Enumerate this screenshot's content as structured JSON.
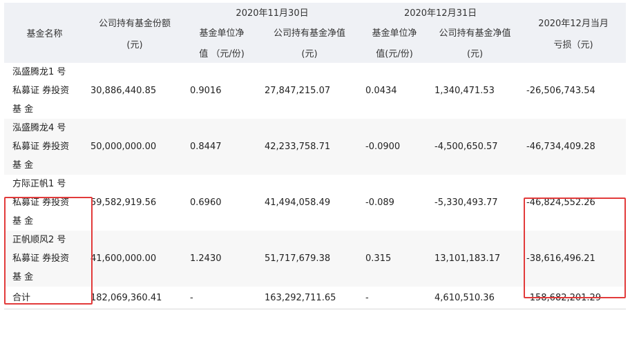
{
  "headers": {
    "fund_name": "基金名称",
    "company_shares": "公司持有基金份额",
    "company_shares_unit": "(元)",
    "period1": "2020年11月30日",
    "period2": "2020年12月31日",
    "nav1_line1": "基金单位净",
    "nav1_line2": "值 （元/份)",
    "net_value1_line1": "公司持有基金净值",
    "net_value1_line2": "(元)",
    "nav2_line1": "基金单位净",
    "nav2_line2": "值(元/份)",
    "net_value2_line1": "公司持有基金净值",
    "net_value2_line2": "(元)",
    "loss_line1": "2020年12月当月",
    "loss_line2": "亏损（元)"
  },
  "rows": [
    {
      "name1": "泓盛腾龙1 号",
      "name2": "私募证 券投资",
      "name3": "基 金",
      "shares": "30,886,440.85",
      "nav1": "0.9016",
      "value1": "27,847,215.07",
      "nav2": "0.0434",
      "value2": "1,340,471.53",
      "loss": "-26,506,743.54"
    },
    {
      "name1": "泓盛腾龙4 号",
      "name2": "私募证 券投资",
      "name3": "基 金",
      "shares": "50,000,000.00",
      "nav1": "0.8447",
      "value1": "42,233,758.71",
      "nav2": "-0.0900",
      "value2": "-4,500,650.57",
      "loss": "-46,734,409.28"
    },
    {
      "name1": "方际正帆1 号",
      "name2": "私募证 券投资",
      "name3": "基 金",
      "shares": "59,582,919.56",
      "nav1": "0.6960",
      "value1": "41,494,058.49",
      "nav2": "-0.089",
      "value2": "-5,330,493.77",
      "loss": "-46,824,552.26"
    },
    {
      "name1": "正帆顺风2 号",
      "name2": "私募证 券投资",
      "name3": "基 金",
      "shares": "41,600,000.00",
      "nav1": "1.2430",
      "value1": "51,717,679.38",
      "nav2": "0.315",
      "value2": "13,101,183.17",
      "loss": "-38,616,496.21"
    }
  ],
  "total": {
    "name": "合计",
    "shares": "182,069,360.41",
    "nav1": "-",
    "value1": "163,292,711.65",
    "nav2": "-",
    "value2": "4,610,510.36",
    "loss": "-158,682,201.29"
  },
  "colors": {
    "highlight": "#e23a3a",
    "header_bg": "#eff1f5",
    "alt_row_bg": "#f7f7f7"
  }
}
